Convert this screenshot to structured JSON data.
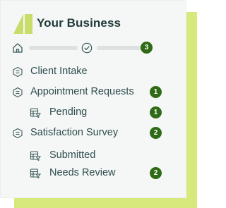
{
  "app": {
    "title": "Your Business",
    "colors": {
      "accent": "#d7e87c",
      "badge": "#2f6b16",
      "text": "#2e4d4d",
      "title": "#1f3a3a",
      "panel": "#f5f6f6"
    }
  },
  "toolbar": {
    "home_icon": "home-icon",
    "check_icon": "check-circle-icon",
    "count": "3"
  },
  "nav": {
    "items": [
      {
        "label": "Client Intake",
        "icon": "form-list-icon",
        "badge": ""
      },
      {
        "label": "Appointment Requests",
        "icon": "form-list-icon",
        "badge": "1"
      },
      {
        "label": "Pending",
        "icon": "table-filter-icon",
        "badge": "1"
      },
      {
        "label": "Satisfaction Survey",
        "icon": "form-list-icon",
        "badge": "2"
      },
      {
        "label": "Submitted",
        "icon": "table-filter-icon",
        "badge": ""
      },
      {
        "label": "Needs Review",
        "icon": "table-filter-icon",
        "badge": "2"
      }
    ]
  }
}
